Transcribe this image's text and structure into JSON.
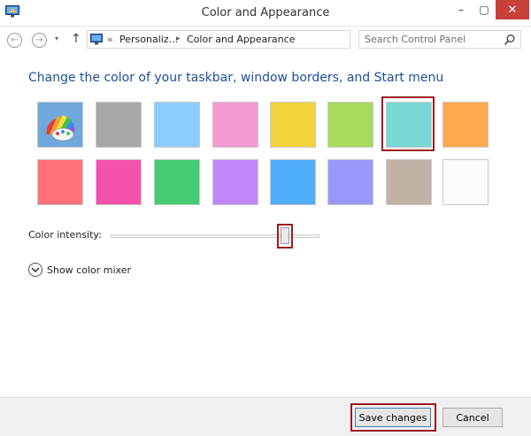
{
  "window": {
    "title": "Color and Appearance",
    "minimize": "–",
    "maximize": "▢",
    "close": "✕"
  },
  "nav": {
    "back": "←",
    "forward": "→",
    "recent": "▾",
    "up": "↑",
    "breadcrumb_lead": "«",
    "breadcrumb": [
      "Personaliz...",
      "Color and Appearance"
    ],
    "breadcrumb_sep": "▸",
    "dropdown": "▾",
    "refresh": "↻"
  },
  "search": {
    "placeholder": "Search Control Panel"
  },
  "main": {
    "heading": "Change the color of your taskbar, window borders, and Start menu",
    "swatches_row1": [
      {
        "name": "automatic",
        "color": "#6fa8dc"
      },
      {
        "name": "gray",
        "color": "#a8a8a8"
      },
      {
        "name": "sky-blue",
        "color": "#8ccdff"
      },
      {
        "name": "pink",
        "color": "#f59ad3"
      },
      {
        "name": "yellow",
        "color": "#f2d33a"
      },
      {
        "name": "lime",
        "color": "#a9d95e"
      },
      {
        "name": "teal",
        "color": "#78d9d5",
        "selected": true
      },
      {
        "name": "orange",
        "color": "#ffab4d"
      }
    ],
    "swatches_row2": [
      {
        "name": "coral",
        "color": "#ff7078"
      },
      {
        "name": "magenta",
        "color": "#f552ab"
      },
      {
        "name": "green",
        "color": "#44cc72"
      },
      {
        "name": "violet",
        "color": "#c285fa"
      },
      {
        "name": "blue",
        "color": "#50adfc"
      },
      {
        "name": "periwinkle",
        "color": "#9998fb"
      },
      {
        "name": "taupe",
        "color": "#c1b2a6"
      },
      {
        "name": "white",
        "color": "#fbfbfb"
      }
    ],
    "intensity_label": "Color intensity:",
    "intensity_level_percent": 85,
    "mixer_label": "Show color mixer"
  },
  "footer": {
    "save_label": "Save changes",
    "cancel_label": "Cancel"
  },
  "colors": {
    "heading": "#1e4e9a",
    "highlight": "#9b1b1e",
    "close_button": "#c7403a"
  }
}
